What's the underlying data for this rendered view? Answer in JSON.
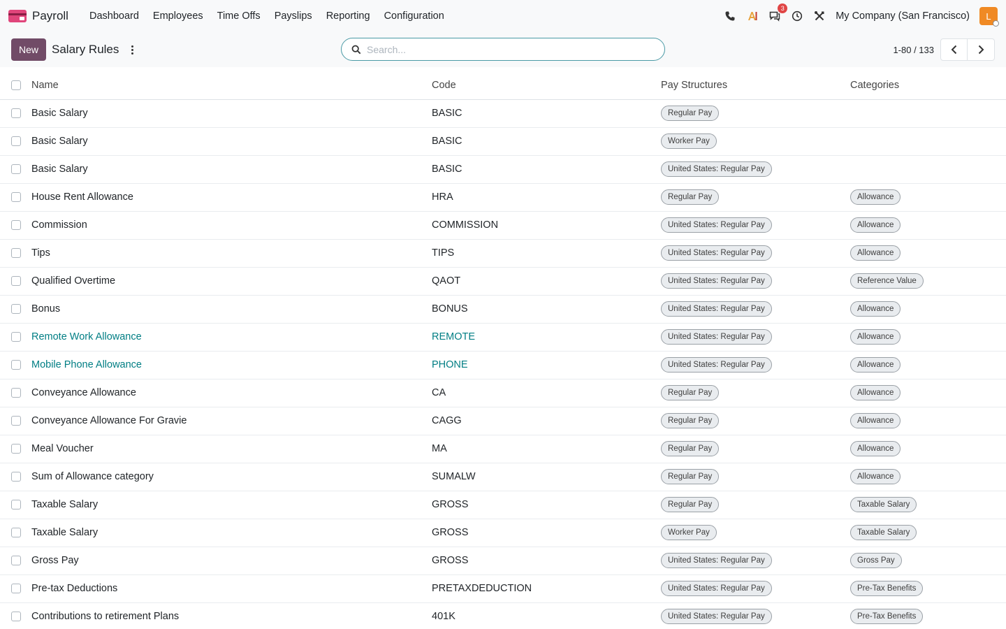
{
  "navbar": {
    "app_name": "Payroll",
    "menu": [
      "Dashboard",
      "Employees",
      "Time Offs",
      "Payslips",
      "Reporting",
      "Configuration"
    ],
    "messages_badge": "3",
    "company": "My Company (San Francisco)",
    "avatar_initial": "L",
    "icons": [
      "phone-icon",
      "ai-icon",
      "messages-icon",
      "clock-icon",
      "tools-icon"
    ]
  },
  "control": {
    "new_label": "New",
    "title": "Salary Rules",
    "search_placeholder": "Search...",
    "pager": "1-80 / 133"
  },
  "columns": {
    "name": "Name",
    "code": "Code",
    "structures": "Pay Structures",
    "categories": "Categories"
  },
  "rows": [
    {
      "name": "Basic Salary",
      "code": "BASIC",
      "structure": "Regular Pay",
      "category": "",
      "link": false
    },
    {
      "name": "Basic Salary",
      "code": "BASIC",
      "structure": "Worker Pay",
      "category": "",
      "link": false
    },
    {
      "name": "Basic Salary",
      "code": "BASIC",
      "structure": "United States: Regular Pay",
      "category": "",
      "link": false
    },
    {
      "name": "House Rent Allowance",
      "code": "HRA",
      "structure": "Regular Pay",
      "category": "Allowance",
      "link": false
    },
    {
      "name": "Commission",
      "code": "COMMISSION",
      "structure": "United States: Regular Pay",
      "category": "Allowance",
      "link": false
    },
    {
      "name": "Tips",
      "code": "TIPS",
      "structure": "United States: Regular Pay",
      "category": "Allowance",
      "link": false
    },
    {
      "name": "Qualified Overtime",
      "code": "QAOT",
      "structure": "United States: Regular Pay",
      "category": "Reference Value",
      "link": false
    },
    {
      "name": "Bonus",
      "code": "BONUS",
      "structure": "United States: Regular Pay",
      "category": "Allowance",
      "link": false
    },
    {
      "name": "Remote Work Allowance",
      "code": "REMOTE",
      "structure": "United States: Regular Pay",
      "category": "Allowance",
      "link": true
    },
    {
      "name": "Mobile Phone Allowance",
      "code": "PHONE",
      "structure": "United States: Regular Pay",
      "category": "Allowance",
      "link": true
    },
    {
      "name": "Conveyance Allowance",
      "code": "CA",
      "structure": "Regular Pay",
      "category": "Allowance",
      "link": false
    },
    {
      "name": "Conveyance Allowance For Gravie",
      "code": "CAGG",
      "structure": "Regular Pay",
      "category": "Allowance",
      "link": false
    },
    {
      "name": "Meal Voucher",
      "code": "MA",
      "structure": "Regular Pay",
      "category": "Allowance",
      "link": false
    },
    {
      "name": "Sum of Allowance category",
      "code": "SUMALW",
      "structure": "Regular Pay",
      "category": "Allowance",
      "link": false
    },
    {
      "name": "Taxable Salary",
      "code": "GROSS",
      "structure": "Regular Pay",
      "category": "Taxable Salary",
      "link": false
    },
    {
      "name": "Taxable Salary",
      "code": "GROSS",
      "structure": "Worker Pay",
      "category": "Taxable Salary",
      "link": false
    },
    {
      "name": "Gross Pay",
      "code": "GROSS",
      "structure": "United States: Regular Pay",
      "category": "Gross Pay",
      "link": false
    },
    {
      "name": "Pre-tax Deductions",
      "code": "PRETAXDEDUCTION",
      "structure": "United States: Regular Pay",
      "category": "Pre-Tax Benefits",
      "link": false
    },
    {
      "name": "Contributions to retirement Plans",
      "code": "401K",
      "structure": "United States: Regular Pay",
      "category": "Pre-Tax Benefits",
      "link": false
    }
  ]
}
